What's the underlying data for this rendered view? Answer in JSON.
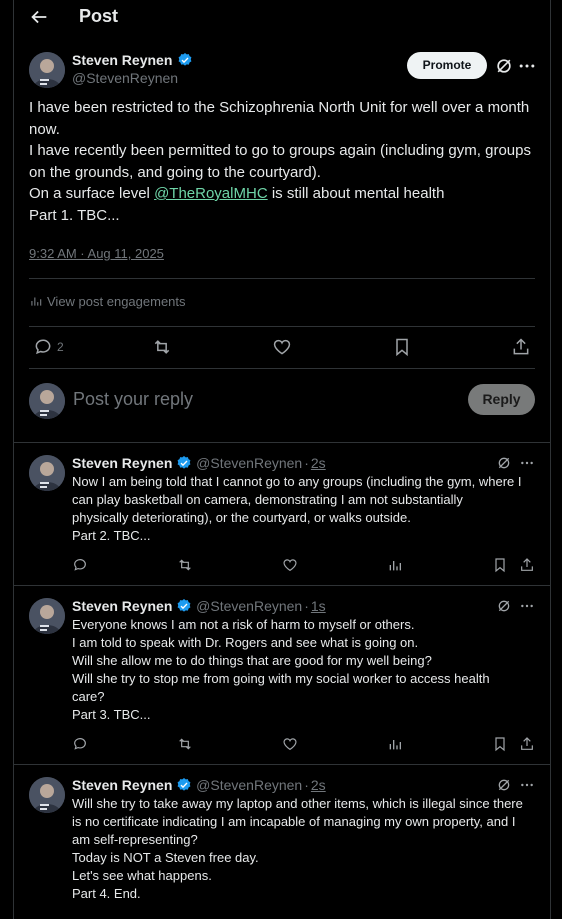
{
  "header": {
    "title": "Post",
    "back_icon": "arrow-left-icon"
  },
  "main_post": {
    "author_name": "Steven Reynen",
    "author_handle": "@StevenReynen",
    "promote_label": "Promote",
    "text_lines": [
      "I have been restricted to the Schizophrenia North Unit for well over a month now.",
      "I have recently been permitted to go to groups again (including gym, groups on the grounds, and going to the courtyard).",
      "On a surface level ",
      "Part 1. TBC..."
    ],
    "mention": "@TheRoyalMHC",
    "mention_suffix": " is still about mental health",
    "timestamp": "9:32 AM · Aug 11, 2025",
    "engagements_label": "View post engagements",
    "reply_count": "2"
  },
  "composer": {
    "placeholder": "Post your reply",
    "reply_label": "Reply"
  },
  "replies": [
    {
      "author_name": "Steven Reynen",
      "author_handle": "@StevenReynen",
      "age": "2s",
      "lines": [
        "Now I am being told that I cannot go to any groups (including the gym, where I",
        "can play basketball on camera, demonstrating I am not substantially",
        "physically deteriorating), or the courtyard, or walks outside.",
        "Part 2. TBC..."
      ]
    },
    {
      "author_name": "Steven Reynen",
      "author_handle": "@StevenReynen",
      "age": "1s",
      "lines": [
        "Everyone knows I am not a risk of harm to myself or others.",
        "I am told to speak with Dr. Rogers and see what is going on.",
        "Will she allow me to do things that are good for my well being?",
        "Will she try to stop me from going with my social worker to access health",
        "care?",
        "Part 3. TBC..."
      ]
    },
    {
      "author_name": "Steven Reynen",
      "author_handle": "@StevenReynen",
      "age": "2s",
      "lines": [
        "Will she try to take away my laptop and other items, which is illegal since there",
        "is no certificate indicating I am incapable of managing my own property, and I",
        "am self-representing?",
        "Today is NOT a Steven free day.",
        "Let's see what happens.",
        "Part 4. End."
      ]
    }
  ],
  "colors": {
    "accent_link": "#6fd5a8",
    "verified": "#1d9bf0",
    "muted": "#71767b",
    "divider": "#2f3336"
  }
}
